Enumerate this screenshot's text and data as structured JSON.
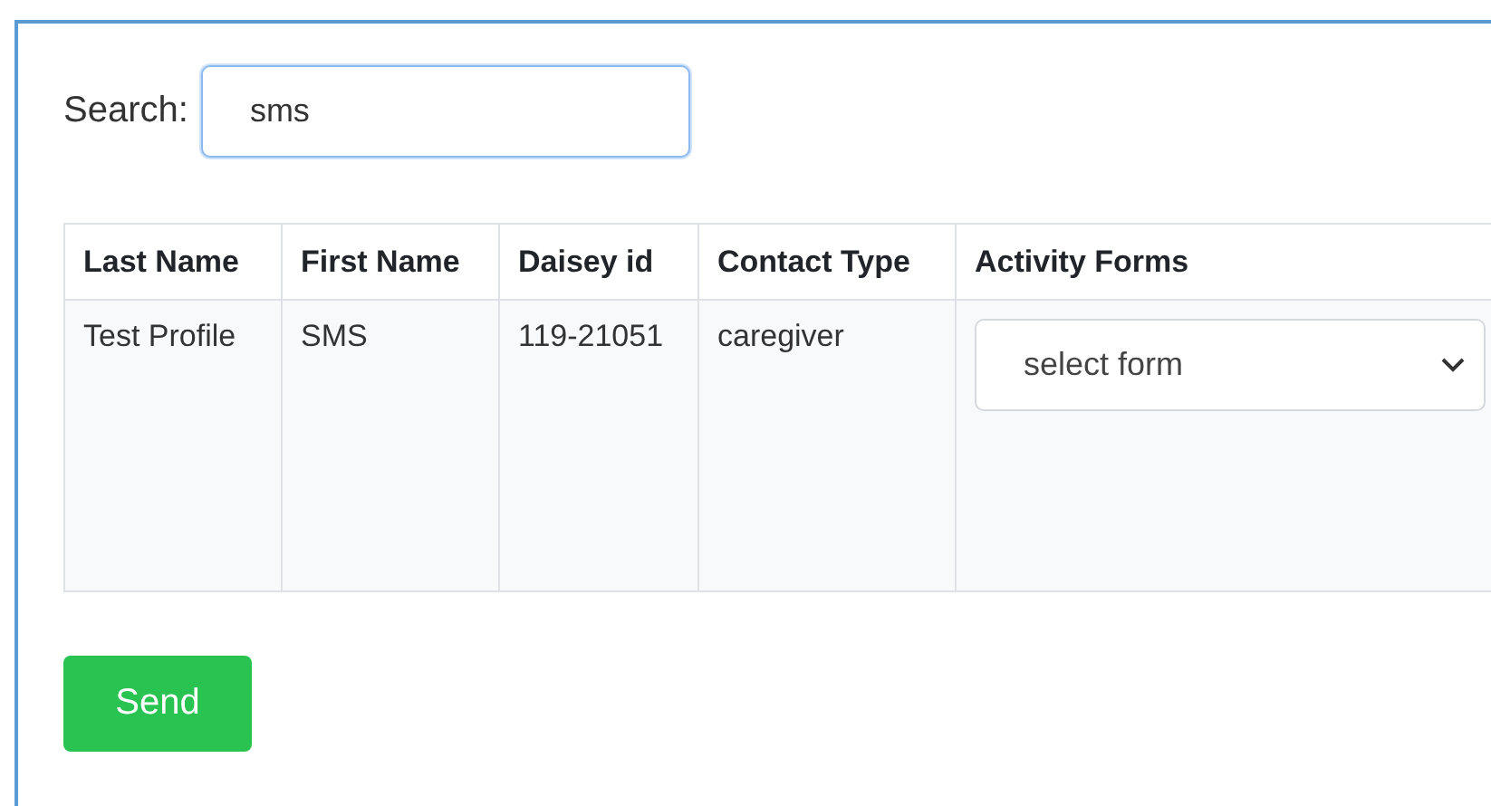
{
  "search": {
    "label": "Search:",
    "value": "sms"
  },
  "table": {
    "columns": [
      "Last Name",
      "First Name",
      "Daisey id",
      "Contact Type",
      "Activity Forms"
    ],
    "rows": [
      {
        "cells": [
          "Test Profile",
          "SMS",
          "119-21051",
          "caregiver"
        ],
        "form_select": {
          "value": "select form"
        }
      }
    ]
  },
  "buttons": [
    {
      "label": "Send"
    }
  ]
}
